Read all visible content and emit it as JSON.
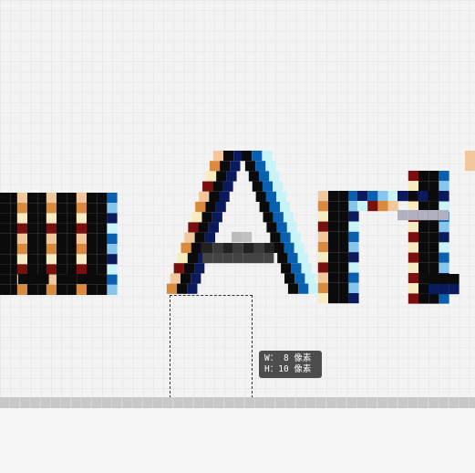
{
  "tooltip": {
    "width_line": "W： 8 像素",
    "height_line": "H：10 像素"
  },
  "colors": {
    "canvas_bg": "#f3f3f3",
    "grid": "#e9e9e9",
    "ruler": "#c8c8c8",
    "tooltip_bg": "#4d4d4d",
    "glyph_dark": "#0b0b0b",
    "glyph_navy": "#0a1a5c",
    "glyph_blue": "#0a60b0",
    "glyph_sky": "#86c6ec",
    "glyph_cyan": "#c8f4f8",
    "glyph_maroon": "#7a0f10",
    "glyph_orange": "#d98a3c",
    "glyph_peach": "#f2c79c",
    "glyph_cream": "#f7ecc0"
  }
}
